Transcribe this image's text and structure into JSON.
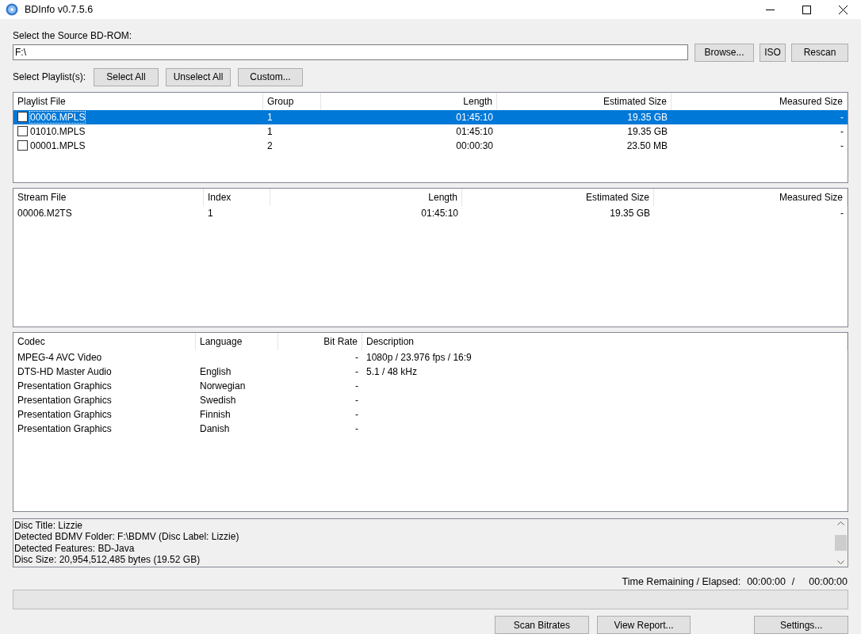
{
  "window": {
    "title": "BDInfo v0.7.5.6"
  },
  "source": {
    "label": "Select the Source BD-ROM:",
    "value": "F:\\",
    "buttons": [
      "Browse...",
      "ISO",
      "Rescan"
    ]
  },
  "playlist_select": {
    "label": "Select Playlist(s):",
    "buttons": [
      "Select All",
      "Unselect All",
      "Custom..."
    ]
  },
  "playlists": {
    "columns": [
      "Playlist File",
      "Group",
      "Length",
      "Estimated Size",
      "Measured Size"
    ],
    "rows": [
      {
        "checked": false,
        "selected": true,
        "cells": [
          "00006.MPLS",
          "1",
          "01:45:10",
          "19.35 GB",
          "-"
        ]
      },
      {
        "checked": false,
        "selected": false,
        "cells": [
          "01010.MPLS",
          "1",
          "01:45:10",
          "19.35 GB",
          "-"
        ]
      },
      {
        "checked": false,
        "selected": false,
        "cells": [
          "00001.MPLS",
          "2",
          "00:00:30",
          "23.50 MB",
          "-"
        ]
      }
    ]
  },
  "streams": {
    "columns": [
      "Stream File",
      "Index",
      "Length",
      "Estimated Size",
      "Measured Size"
    ],
    "rows": [
      {
        "cells": [
          "00006.M2TS",
          "1",
          "01:45:10",
          "19.35 GB",
          "-"
        ]
      }
    ]
  },
  "codecs": {
    "columns": [
      "Codec",
      "Language",
      "Bit Rate",
      "Description"
    ],
    "rows": [
      {
        "cells": [
          "MPEG-4 AVC Video",
          "",
          "-",
          "1080p / 23.976 fps / 16:9"
        ]
      },
      {
        "cells": [
          "DTS-HD Master Audio",
          "English",
          "-",
          "5.1 / 48 kHz"
        ]
      },
      {
        "cells": [
          "Presentation Graphics",
          "Norwegian",
          "-",
          ""
        ]
      },
      {
        "cells": [
          "Presentation Graphics",
          "Swedish",
          "-",
          ""
        ]
      },
      {
        "cells": [
          "Presentation Graphics",
          "Finnish",
          "-",
          ""
        ]
      },
      {
        "cells": [
          "Presentation Graphics",
          "Danish",
          "-",
          ""
        ]
      }
    ]
  },
  "log": [
    "Disc Title: Lizzie",
    "Detected BDMV Folder: F:\\BDMV (Disc Label: Lizzie)",
    "Detected Features: BD-Java",
    "Disc Size: 20,954,512,485 bytes (19.52 GB)"
  ],
  "time": {
    "label": "Time Remaining / Elapsed:",
    "remaining": "00:00:00",
    "separator": "/",
    "elapsed": "00:00:00"
  },
  "progress": {
    "level": 0
  },
  "buttons": [
    "Scan Bitrates",
    "View Report...",
    "Settings..."
  ]
}
